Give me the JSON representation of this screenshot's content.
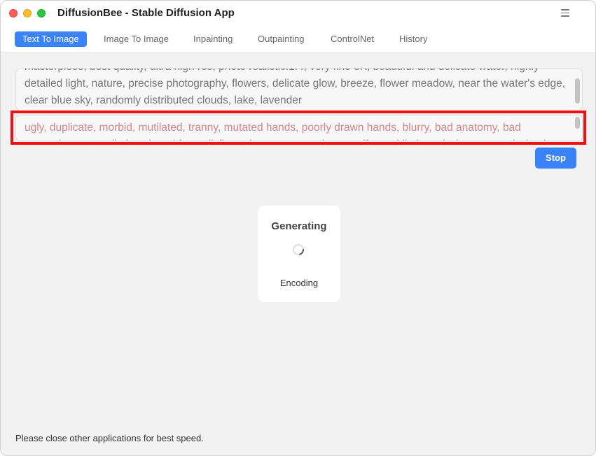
{
  "window": {
    "title": "DiffusionBee - Stable Diffusion App"
  },
  "tabs": [
    {
      "label": "Text To Image",
      "active": true
    },
    {
      "label": "Image To Image",
      "active": false
    },
    {
      "label": "Inpainting",
      "active": false
    },
    {
      "label": "Outpainting",
      "active": false
    },
    {
      "label": "ControlNet",
      "active": false
    },
    {
      "label": "History",
      "active": false
    }
  ],
  "prompt": {
    "value": "masterpiece, best quality, ultra high res, photo realistic:1.4, very fine 8K, beautiful and delicate water, highly detailed light, nature, precise photography, flowers, delicate glow, breeze, flower meadow, near the water's edge, clear blue sky, randomly distributed clouds, lake, lavender"
  },
  "negative_prompt": {
    "value": "ugly, duplicate, morbid, mutilated, tranny, mutated hands, poorly drawn hands, blurry, bad anatomy, bad proportions, extra limbs, cloned face, disfigured, gross proportions, malformed limbs, missing arms, missing legs",
    "text_color": "#d0868c"
  },
  "stop_button": {
    "label": "Stop",
    "color": "#3a82f7"
  },
  "generating": {
    "title": "Generating",
    "status": "Encoding"
  },
  "footer": {
    "note": "Please close other applications for best speed."
  },
  "icons": {
    "menu": "hamburger-menu-icon",
    "spinner": "loading-spinner-icon"
  },
  "colors": {
    "accent": "#3a82f7",
    "highlight": "#ee1111"
  }
}
